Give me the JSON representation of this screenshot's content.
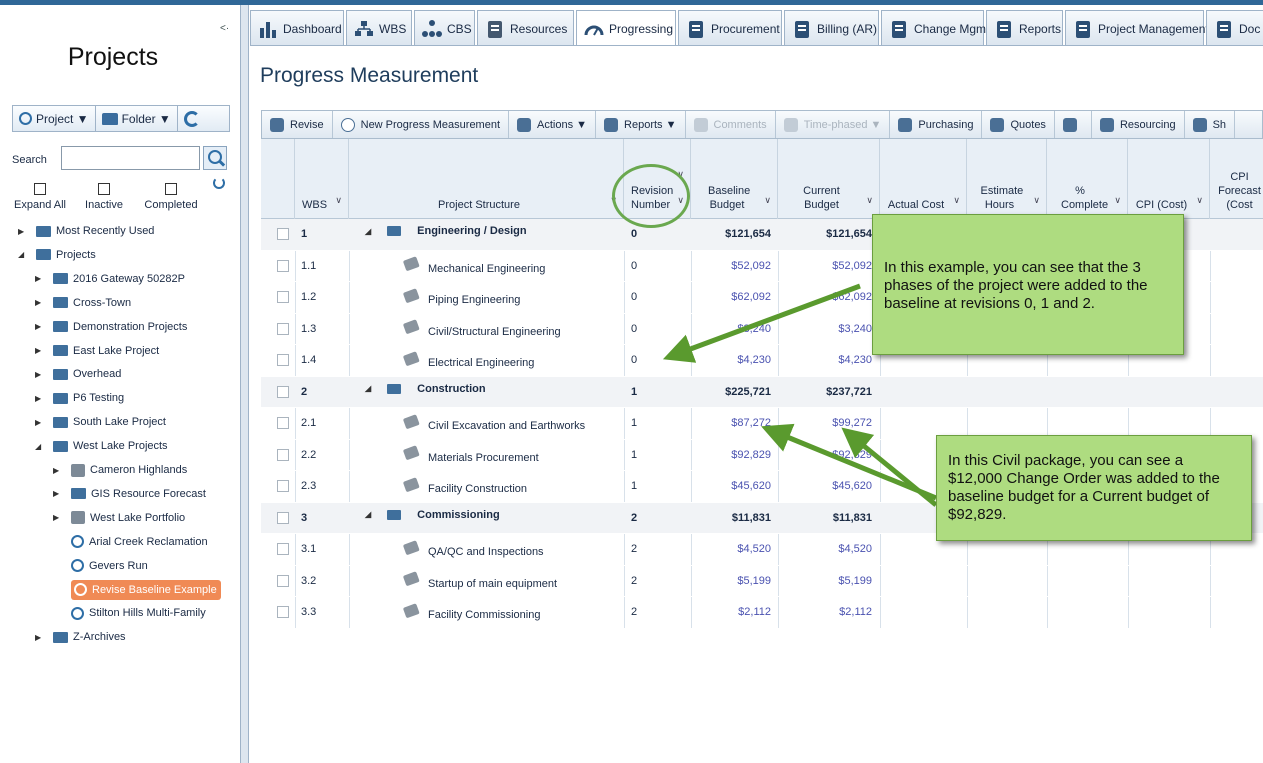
{
  "left_panel": {
    "title": "Projects",
    "toolbar": {
      "project": "Project ▼",
      "folder": "Folder ▼"
    },
    "search": {
      "label": "Search",
      "value": ""
    },
    "filters": [
      {
        "label": "Expand All"
      },
      {
        "label": "Inactive"
      },
      {
        "label": "Completed"
      }
    ],
    "tree": [
      {
        "label": "Most Recently Used",
        "type": "folder",
        "level": 1,
        "toggle": "▶"
      },
      {
        "label": "Projects",
        "type": "folder",
        "level": 1,
        "toggle": "◢"
      },
      {
        "label": "2016 Gateway 50282P",
        "type": "folder",
        "level": 2,
        "toggle": "▶"
      },
      {
        "label": "Cross-Town",
        "type": "folder",
        "level": 2,
        "toggle": "▶"
      },
      {
        "label": "Demonstration Projects",
        "type": "folder",
        "level": 2,
        "toggle": "▶"
      },
      {
        "label": "East Lake Project",
        "type": "folder",
        "level": 2,
        "toggle": "▶"
      },
      {
        "label": "Overhead",
        "type": "folder",
        "level": 2,
        "toggle": "▶"
      },
      {
        "label": "P6 Testing",
        "type": "folder",
        "level": 2,
        "toggle": "▶"
      },
      {
        "label": "South Lake Project",
        "type": "folder",
        "level": 2,
        "toggle": "▶"
      },
      {
        "label": "West Lake Projects",
        "type": "folder",
        "level": 2,
        "toggle": "◢"
      },
      {
        "label": "Cameron Highlands",
        "type": "doc",
        "level": 3,
        "toggle": "▶"
      },
      {
        "label": "GIS Resource Forecast",
        "type": "folder",
        "level": 3,
        "toggle": "▶"
      },
      {
        "label": "West Lake Portfolio",
        "type": "doc",
        "level": 3,
        "toggle": "▶"
      },
      {
        "label": "Arial Creek Reclamation",
        "type": "project",
        "level": 3,
        "toggle": ""
      },
      {
        "label": "Gevers Run",
        "type": "project",
        "level": 3,
        "toggle": ""
      },
      {
        "label": "Revise Baseline Example",
        "type": "project",
        "level": 3,
        "toggle": "",
        "selected": true
      },
      {
        "label": "Stilton Hills Multi-Family",
        "type": "project",
        "level": 3,
        "toggle": ""
      },
      {
        "label": "Z-Archives",
        "type": "folder",
        "level": 2,
        "toggle": "▶"
      }
    ]
  },
  "tabs": [
    {
      "label": "Dashboard",
      "icon": "bar-chart-icon"
    },
    {
      "label": "WBS",
      "icon": "wbs-icon"
    },
    {
      "label": "CBS",
      "icon": "cbs-icon"
    },
    {
      "label": "Resources",
      "icon": "resources-icon"
    },
    {
      "label": "Progressing",
      "icon": "gauge-icon",
      "active": true
    },
    {
      "label": "Procurement",
      "icon": "procurement-icon"
    },
    {
      "label": "Billing (AR)",
      "icon": "billing-icon"
    },
    {
      "label": "Change Mgmt",
      "icon": "change-icon"
    },
    {
      "label": "Reports",
      "icon": "clipboard-icon"
    },
    {
      "label": "Project Management",
      "icon": "book-icon"
    },
    {
      "label": "Doc",
      "icon": "doc-icon"
    }
  ],
  "main": {
    "title": "Progress Measurement",
    "toolbar": [
      {
        "label": "Revise",
        "icon": "revise-icon"
      },
      {
        "label": "New Progress Measurement",
        "icon": "plus-icon"
      },
      {
        "label": "Actions ▼",
        "icon": "wand-icon"
      },
      {
        "label": "Reports ▼",
        "icon": "clipboard-icon"
      },
      {
        "label": "Comments",
        "icon": "comment-icon",
        "disabled": true
      },
      {
        "label": "Time-phased ▼",
        "icon": "line-chart-icon",
        "disabled": true
      },
      {
        "label": "Purchasing",
        "icon": "purchasing-icon"
      },
      {
        "label": "Quotes",
        "icon": "quotes-icon"
      },
      {
        "label": "",
        "icon": "export-icon"
      },
      {
        "label": "Resourcing",
        "icon": "people-icon"
      },
      {
        "label": "Sh",
        "icon": "eye-icon"
      }
    ],
    "columns": [
      {
        "key": "wbs",
        "label": "WBS"
      },
      {
        "key": "structure",
        "label": "Project Structure"
      },
      {
        "key": "revision",
        "label": "Revision Number"
      },
      {
        "key": "baseline",
        "label": "Baseline Budget"
      },
      {
        "key": "current",
        "label": "Current Budget"
      },
      {
        "key": "actual",
        "label": "Actual Cost"
      },
      {
        "key": "est_hours",
        "label": "Estimate Hours"
      },
      {
        "key": "pct",
        "label": "% Complete"
      },
      {
        "key": "cpi",
        "label": "CPI (Cost)"
      },
      {
        "key": "cpi_fc",
        "label": "CPI Forecast (Cost"
      }
    ],
    "rows": [
      {
        "wbs": "1",
        "name": "Engineering / Design",
        "group": true,
        "revision": "0",
        "baseline": "$121,654",
        "current": "$121,654"
      },
      {
        "wbs": "1.1",
        "name": "Mechanical Engineering",
        "revision": "0",
        "baseline": "$52,092",
        "current": "$52,092"
      },
      {
        "wbs": "1.2",
        "name": "Piping Engineering",
        "revision": "0",
        "baseline": "$62,092",
        "current": "$62,092"
      },
      {
        "wbs": "1.3",
        "name": "Civil/Structural Engineering",
        "revision": "0",
        "baseline": "$3,240",
        "current": "$3,240"
      },
      {
        "wbs": "1.4",
        "name": "Electrical Engineering",
        "revision": "0",
        "baseline": "$4,230",
        "current": "$4,230"
      },
      {
        "wbs": "2",
        "name": "Construction",
        "group": true,
        "revision": "1",
        "baseline": "$225,721",
        "current": "$237,721"
      },
      {
        "wbs": "2.1",
        "name": "Civil Excavation and Earthworks",
        "revision": "1",
        "baseline": "$87,272",
        "current": "$99,272"
      },
      {
        "wbs": "2.2",
        "name": "Materials Procurement",
        "revision": "1",
        "baseline": "$92,829",
        "current": "$92,829"
      },
      {
        "wbs": "2.3",
        "name": "Facility Construction",
        "revision": "1",
        "baseline": "$45,620",
        "current": "$45,620"
      },
      {
        "wbs": "3",
        "name": "Commissioning",
        "group": true,
        "revision": "2",
        "baseline": "$11,831",
        "current": "$11,831"
      },
      {
        "wbs": "3.1",
        "name": "QA/QC and Inspections",
        "revision": "2",
        "baseline": "$4,520",
        "current": "$4,520"
      },
      {
        "wbs": "3.2",
        "name": "Startup of main equipment",
        "revision": "2",
        "baseline": "$5,199",
        "current": "$5,199"
      },
      {
        "wbs": "3.3",
        "name": "Facility Commissioning",
        "revision": "2",
        "baseline": "$2,112",
        "current": "$2,112"
      }
    ]
  },
  "annotations": {
    "note1": "In this example, you can see that the 3 phases of the project were added to the baseline at revisions 0, 1 and 2.",
    "note2": "In this Civil package, you can see a $12,000 Change Order was added to the baseline budget for a Current budget of $92,829.",
    "color": "#aedc80",
    "arrow_color": "#5a9a2e"
  }
}
